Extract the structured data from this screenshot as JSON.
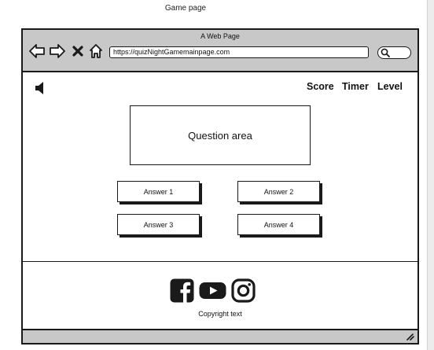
{
  "caption": "Game page",
  "window": {
    "title": "A Web Page"
  },
  "toolbar": {
    "icons": [
      "back-arrow-icon",
      "forward-arrow-icon",
      "close-x-icon",
      "home-icon"
    ],
    "url": "https://quizNightGamemainpage.com",
    "search_icon": "search-icon"
  },
  "header": {
    "sound_icon": "speaker-icon",
    "score_label": "Score",
    "timer_label": "Timer",
    "level_label": "Level"
  },
  "quiz": {
    "question": "Question area",
    "answers": [
      "Answer 1",
      "Answer 2",
      "Answer 3",
      "Answer 4"
    ]
  },
  "footer": {
    "social_icons": [
      "facebook-icon",
      "youtube-icon",
      "instagram-icon"
    ],
    "copyright": "Copyright text"
  },
  "colors": {
    "chrome": "#c8c8c8",
    "ink": "#1a1a1a",
    "background": "#ffffff"
  }
}
